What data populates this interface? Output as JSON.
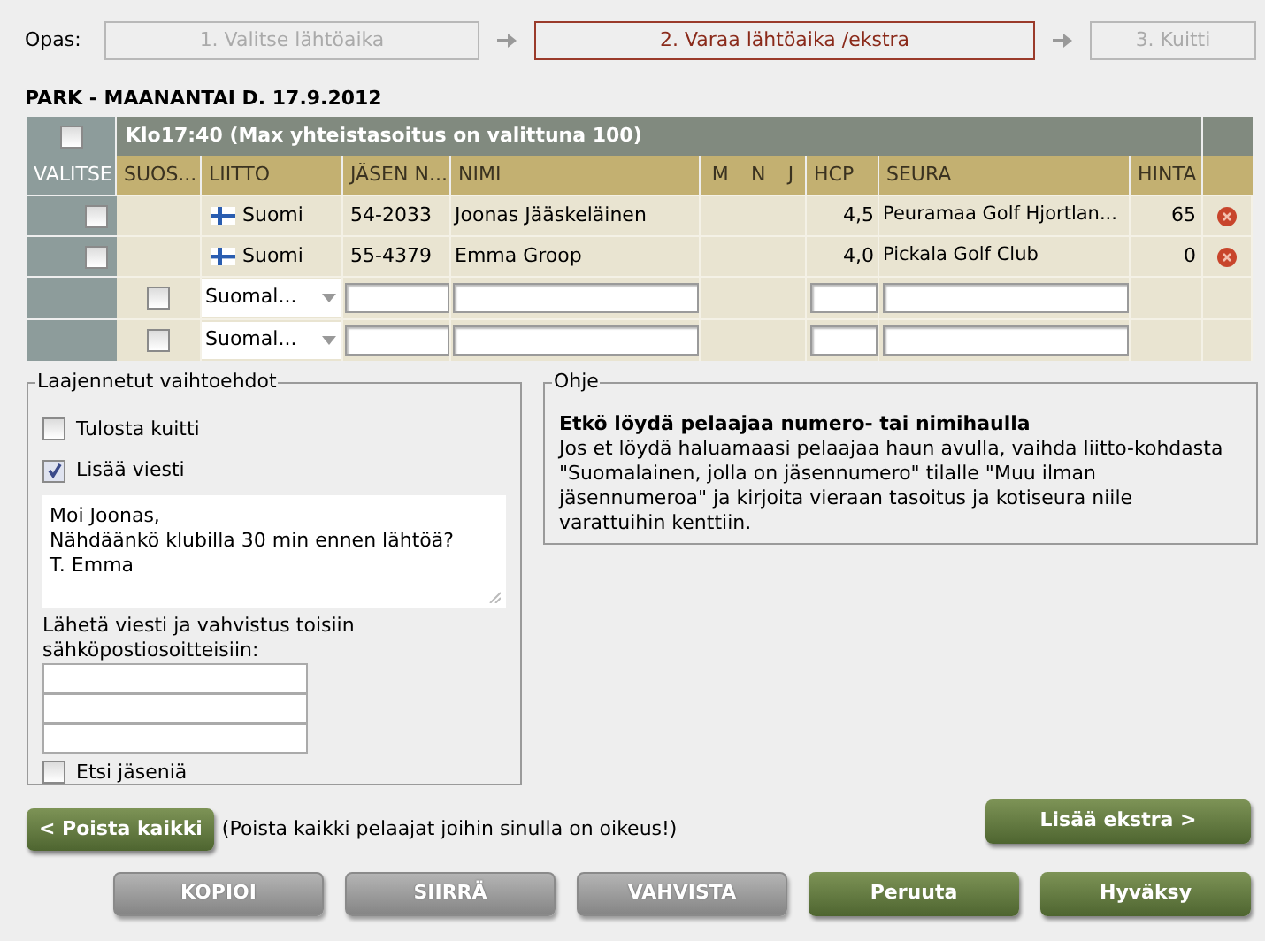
{
  "guide": {
    "label": "Opas:",
    "steps": [
      {
        "label": "1. Valitse lähtöaika",
        "selected": false
      },
      {
        "label": "2. Varaa lähtöaika /ekstra",
        "selected": true
      },
      {
        "label": "3. Kuitti",
        "selected": false
      }
    ]
  },
  "heading": "PARK - MAANANTAI D. 17.9.2012",
  "table": {
    "title": "Klo17:40 (Max yhteistasoitus on valittuna 100)",
    "select_all_checked": false,
    "columns": [
      "VALITSE",
      "SUOS...",
      "LIITTO",
      "JÄSEN N...",
      "NIMI",
      "M",
      "N",
      "J",
      "HCP",
      "SEURA",
      "HINTA"
    ],
    "rows": [
      {
        "kind": "player",
        "checked": false,
        "federation": "Suomi",
        "member_no": "54-2033",
        "name": "Joonas Jääskeläinen",
        "hcp": "4,5",
        "club": "Peuramaa Golf Hjortlan...",
        "price": "65"
      },
      {
        "kind": "player",
        "checked": false,
        "federation": "Suomi",
        "member_no": "55-4379",
        "name": "Emma Groop",
        "hcp": "4,0",
        "club": "Pickala Golf Club",
        "price": "0"
      },
      {
        "kind": "entry",
        "checked": false,
        "federation": "Suomal..."
      },
      {
        "kind": "entry",
        "checked": false,
        "federation": "Suomal..."
      }
    ]
  },
  "options": {
    "legend": "Laajennetut vaihtoehdot",
    "print_receipt": {
      "label": "Tulosta kuitti",
      "checked": false
    },
    "add_message": {
      "label": "Lisää viesti",
      "checked": true
    },
    "message": [
      "Moi Joonas,",
      "Nähdäänkö klubilla 30 min ennen lähtöä?",
      "T. Emma"
    ],
    "email_label": "Lähetä viesti ja vahvistus toisiin sähköpostiosoitteisiin:",
    "search_members": {
      "label": "Etsi jäseniä",
      "checked": false
    }
  },
  "help": {
    "legend": "Ohje",
    "title": "Etkö löydä pelaajaa numero- tai nimihaulla",
    "text": "Jos et löydä haluamaasi pelaajaa haun avulla, vaihda liitto-kohdasta \"Suomalainen, jolla on jäsennumero\" tilalle \"Muu ilman jäsennumeroa\" ja kirjoita vieraan tasoitus ja kotiseura niile varattuihin kenttiin."
  },
  "remove_all": {
    "label": "< Poista kaikki",
    "note": "(Poista kaikki pelaajat joihin sinulla on oikeus!)"
  },
  "add_extra": "Lisää ekstra >",
  "buttons": [
    {
      "label": "KOPIOI",
      "disabled": true
    },
    {
      "label": "SIIRRÄ",
      "disabled": true
    },
    {
      "label": "VAHVISTA",
      "disabled": true
    },
    {
      "label": "Peruuta",
      "disabled": false
    },
    {
      "label": "Hyväksy",
      "disabled": false
    }
  ]
}
